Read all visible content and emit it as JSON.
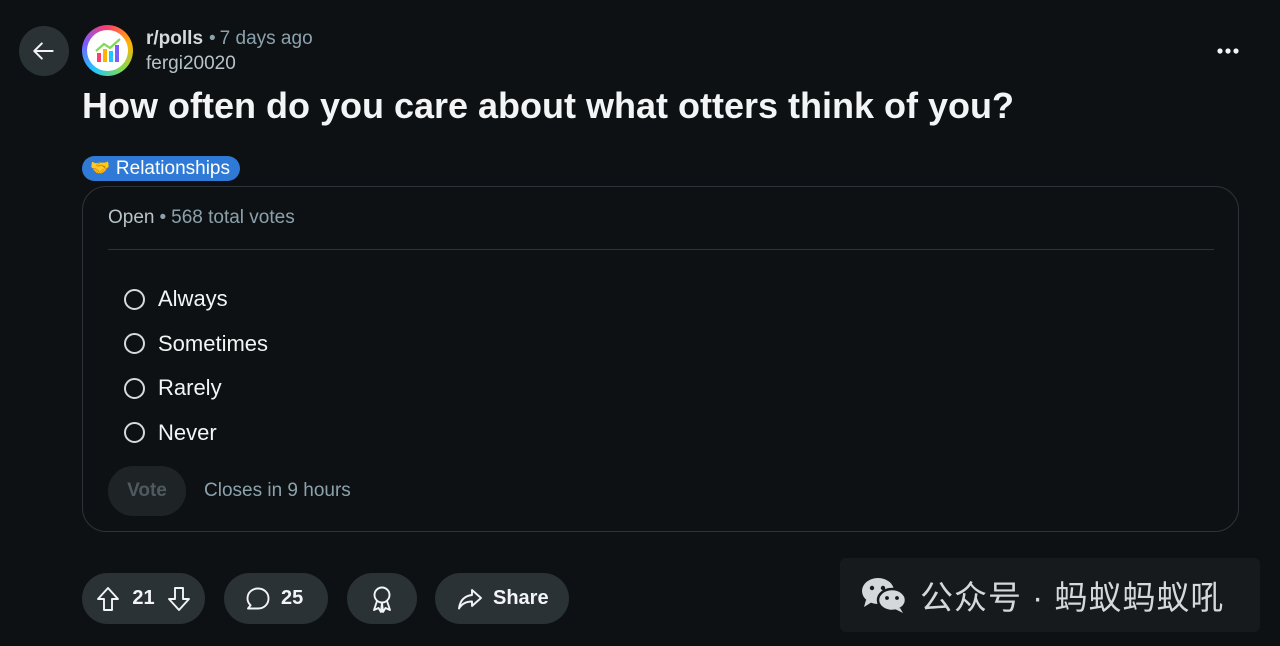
{
  "post": {
    "subreddit": "r/polls",
    "separator": "•",
    "age": "7 days ago",
    "author": "fergi20020",
    "title": "How often do you care about what otters think of you?",
    "flair": {
      "emoji": "🤝",
      "label": "Relationships",
      "color": "#2e7ad6"
    }
  },
  "poll": {
    "status": "Open",
    "separator": "•",
    "total_votes": "568 total votes",
    "options": [
      {
        "label": "Always"
      },
      {
        "label": "Sometimes"
      },
      {
        "label": "Rarely"
      },
      {
        "label": "Never"
      }
    ],
    "vote_label": "Vote",
    "closes": "Closes in 9 hours"
  },
  "actions": {
    "score": "21",
    "comments": "25",
    "share_label": "Share"
  },
  "watermark": {
    "text": "公众号 · 蚂蚁蚂蚁吼"
  },
  "icons": {
    "back": "arrow-left-icon",
    "more": "more-horizontal-icon",
    "upvote": "arrow-up-icon",
    "downvote": "arrow-down-icon",
    "comment": "speech-bubble-icon",
    "award": "award-ribbon-icon",
    "share": "share-arrow-icon",
    "wechat": "wechat-logo-icon"
  },
  "colors": {
    "background": "#0e1113",
    "button_bg": "#2a3236",
    "accent": "#2e7ad6"
  }
}
